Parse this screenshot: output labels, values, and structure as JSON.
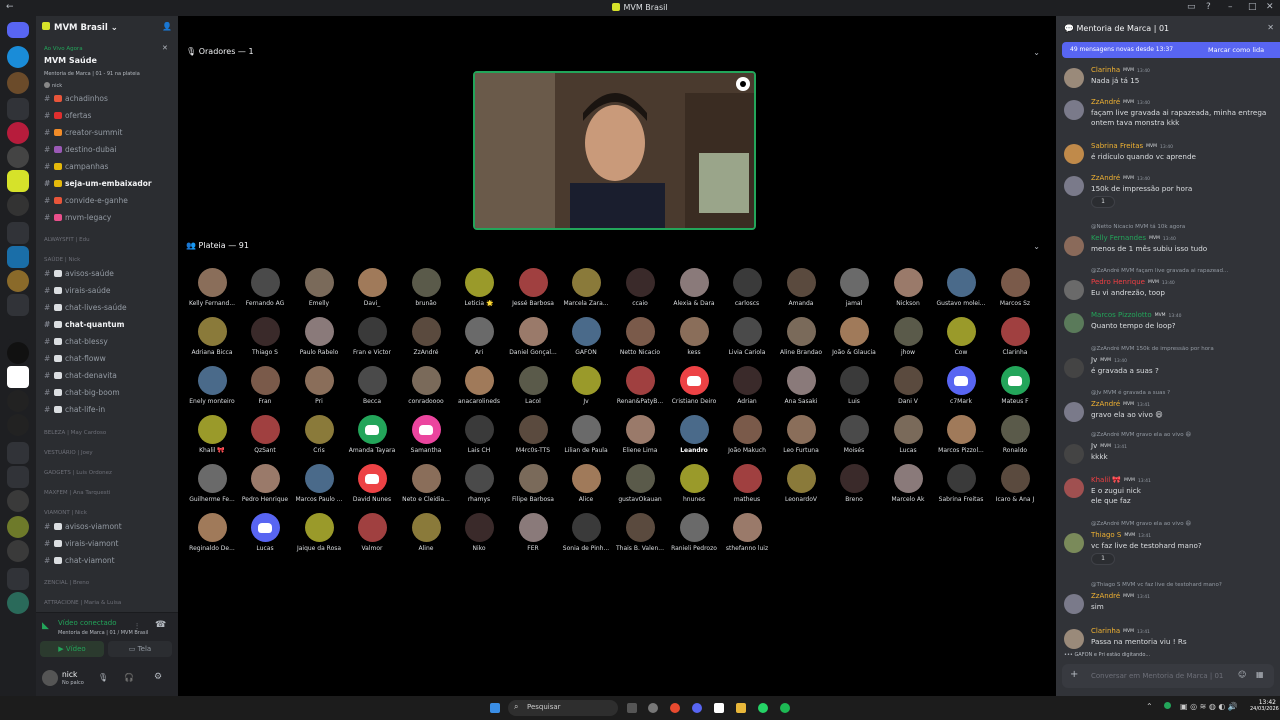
{
  "window": {
    "title": "MVM Brasil"
  },
  "server": {
    "name": "MVM Brasil"
  },
  "live": {
    "status": "Ao Vivo Agora",
    "title": "MVM Saúde",
    "subtitle": "Mentoria de Marca | 01 - 91 na plateia",
    "host": "nick"
  },
  "channels": [
    {
      "name": "achadinhos",
      "bold": false,
      "color": "#e8553a"
    },
    {
      "name": "ofertas",
      "bold": false,
      "color": "#e02e2e"
    },
    {
      "name": "creator-summit",
      "bold": false,
      "color": "#f28c28"
    },
    {
      "name": "destino-dubai",
      "bold": false,
      "color": "#9b59b6"
    },
    {
      "name": "campanhas",
      "bold": false,
      "color": "#e5b90b"
    },
    {
      "name": "seja-um-embaixador",
      "bold": true,
      "color": "#e5b90b"
    },
    {
      "name": "convide-e-ganhe",
      "bold": false,
      "color": "#e8553a"
    },
    {
      "name": "mvm-legacy",
      "bold": false,
      "color": "#e94f8b"
    }
  ],
  "categories": {
    "alwaysfit": "ALWAYSFIT | Edu",
    "saude": "SAÚDE | Nick",
    "beleza": "BELEZA | May Cardoso",
    "vestuario": "VESTUÁRIO | Joey",
    "gadgets": "GADGETS | Luis Ordonez",
    "maxfem": "MAXFEM | Ana Tarquesti",
    "viamont": "VIAMONT | Nick",
    "zencial": "ZENCIAL | Breno",
    "attracione": "ATTRACIONE | Maria & Luisa"
  },
  "saude_channels": [
    {
      "name": "avisos-saúde",
      "bold": false
    },
    {
      "name": "virais-saúde",
      "bold": false
    },
    {
      "name": "chat-lives-saúde",
      "bold": false
    },
    {
      "name": "chat-quantum",
      "bold": true
    },
    {
      "name": "chat-blessy",
      "bold": false
    },
    {
      "name": "chat-floww",
      "bold": false
    },
    {
      "name": "chat-denavita",
      "bold": false
    },
    {
      "name": "chat-big-boom",
      "bold": false
    },
    {
      "name": "chat-life-in",
      "bold": false
    }
  ],
  "viamont_channels": [
    {
      "name": "avisos-viamont"
    },
    {
      "name": "virais-viamont"
    },
    {
      "name": "chat-viamont"
    }
  ],
  "voice": {
    "status": "Vídeo conectado",
    "channel": "Mentoria de Marca | 01 / MVM Brasil",
    "video_label": "Vídeo",
    "screen_label": "Tela"
  },
  "user": {
    "name": "nick",
    "status": "No palco"
  },
  "stage": {
    "speakers_label": "Oradores — 1",
    "audience_label": "Plateia — 91"
  },
  "audience": [
    [
      "Kelly Fernand...",
      "Fernando AG",
      "Emelly",
      "Davi_",
      "brunão",
      "Leticia 🌟",
      "Jessé Barbosa",
      "Marcela Zara...",
      "ccaio",
      "Alexia & Dara",
      "carloscs",
      "Amanda",
      "jamal",
      "Nickson",
      "Gustavo molei...",
      "Marcos Sz"
    ],
    [
      "Adriana Bicca",
      "Thiago S",
      "Paulo Rabelo",
      "Fran e Victor",
      "ZzAndré",
      "Ari",
      "Daniel Gonçal...",
      "GAFON",
      "Netto Nicacio",
      "kess",
      "Livia Cariola",
      "Aline Brandao",
      "João & Glaucia",
      "jhow",
      "Cow",
      "Clarinha"
    ],
    [
      "Enely monteiro",
      "Fran",
      "Pri",
      "Becca",
      "conradoooo",
      "anacarolineds",
      "Lacol",
      "Jv",
      "Renan&PatyB...",
      "Cristiano Deiro",
      "Adrian",
      "Ana Sasaki",
      "Luis",
      "Dani V",
      "c7Mark",
      "Mateus F"
    ],
    [
      "Khalil 🎀",
      "QzSant",
      "Cris",
      "Amanda Tayara",
      "Samantha",
      "Lais CH",
      "M4rc0s-TTS",
      "Lilian de Paula",
      "Eliene Lima",
      "Leandro",
      "João Makuch",
      "Leo Furtuna",
      "Moisés",
      "Lucas",
      "Marcos Pizzol...",
      "Ronaldo"
    ],
    [
      "Guilherme Fe...",
      "Pedro Henrique",
      "Marcos Paulo ...",
      "David Nunes",
      "Neto e Cleidia...",
      "rhamys",
      "Filipe Barbosa",
      "Alice",
      "gustavOkauan",
      "hnunes",
      "matheus",
      "LeonardoV",
      "Breno",
      "Marcelo Ak",
      "Sabrina Freitas",
      "Icaro & Ana J"
    ],
    [
      "Reginaldo De...",
      "Lucas",
      "Jaique da Rosa",
      "Valmor",
      "Aline",
      "Niko",
      "FER",
      "Sonia de Pinh...",
      "Thais B. Valen...",
      "Ranieli Pedrozo",
      "sthefanno luiz"
    ]
  ],
  "chat": {
    "title": "Mentoria de Marca | 01",
    "new_messages": "49 mensagens novas desde 13:37",
    "mark_read": "Marcar como lida",
    "input_placeholder": "Conversar em Mentoria de Marca | 01",
    "typing": "GAFON e Pri estão digitando...",
    "messages": [
      {
        "author": "Clarinha",
        "color": "#f0b232",
        "time": "13:40",
        "text": [
          "Nada já tá 15"
        ]
      },
      {
        "author": "ZzAndré",
        "color": "#f0b232",
        "time": "13:40",
        "text": [
          "façam live gravada ai rapazeada, minha entrega",
          "ontem tava monstra kkk"
        ]
      },
      {
        "author": "Sabrina Freitas",
        "color": "#f0b232",
        "time": "13:40",
        "text": [
          "é ridículo quando vc aprende"
        ]
      },
      {
        "author": "ZzAndré",
        "color": "#f0b232",
        "time": "13:40",
        "text": [
          "150k de impressão por hora"
        ],
        "reaction": "1"
      },
      {
        "reply": "@Netto Nicacio  MVM  tá 10k agora",
        "author": "Kelly Fernandes",
        "color": "#23a55a",
        "time": "13:40",
        "text": [
          "menos de 1 mês subiu isso tudo"
        ]
      },
      {
        "reply": "@ZzAndré  MVM  façam live gravada ai rapazead...",
        "author": "Pedro Henrique",
        "color": "#f23f43",
        "time": "13:40",
        "text": [
          "Eu vi andrezão, toop"
        ]
      },
      {
        "author": "Marcos Pizzolotto",
        "color": "#23a55a",
        "time": "13:40",
        "text": [
          "Quanto tempo de loop?"
        ]
      },
      {
        "reply": "@ZzAndré  MVM  150k de impressão por hora",
        "author": "Jv",
        "color": "#dbdee1",
        "time": "13:40",
        "text": [
          "é gravada a suas ?"
        ]
      },
      {
        "reply": "@Jv  MVM  é gravada a suas ?",
        "author": "ZzAndré",
        "color": "#f0b232",
        "time": "13:41",
        "text": [
          "gravo ela ao vivo 😄"
        ]
      },
      {
        "reply": "@ZzAndré  MVM  gravo ela ao vivo 😄",
        "author": "Jv",
        "color": "#dbdee1",
        "time": "13:41",
        "text": [
          "kkkk"
        ]
      },
      {
        "author": "Khalil 🎀",
        "color": "#f23f43",
        "time": "13:41",
        "text": [
          "E o zugui nick",
          "ele que faz"
        ]
      },
      {
        "reply": "@ZzAndré  MVM  gravo ela ao vivo 😄",
        "author": "Thiago S",
        "color": "#f0b232",
        "time": "13:41",
        "text": [
          "vc faz live de testohard mano?"
        ],
        "reaction": "1"
      },
      {
        "reply": "@Thiago S  MVM  vc faz live de testohard mano?",
        "author": "ZzAndré",
        "color": "#f0b232",
        "time": "13:41",
        "text": [
          "sim"
        ]
      },
      {
        "author": "Clarinha",
        "color": "#f0b232",
        "time": "13:41",
        "text": [
          "Passa na mentoria viu ! Rs"
        ]
      }
    ]
  },
  "taskbar": {
    "search": "Pesquisar",
    "time": "13:42",
    "date": "24/03/2026"
  },
  "colors": {
    "accent": "#5865f2",
    "speaker_border": "#23a55a",
    "discord_red": "#ed4245",
    "discord_green": "#23a55a",
    "discord_pink": "#eb459e",
    "discord_blurple": "#5865f2"
  }
}
